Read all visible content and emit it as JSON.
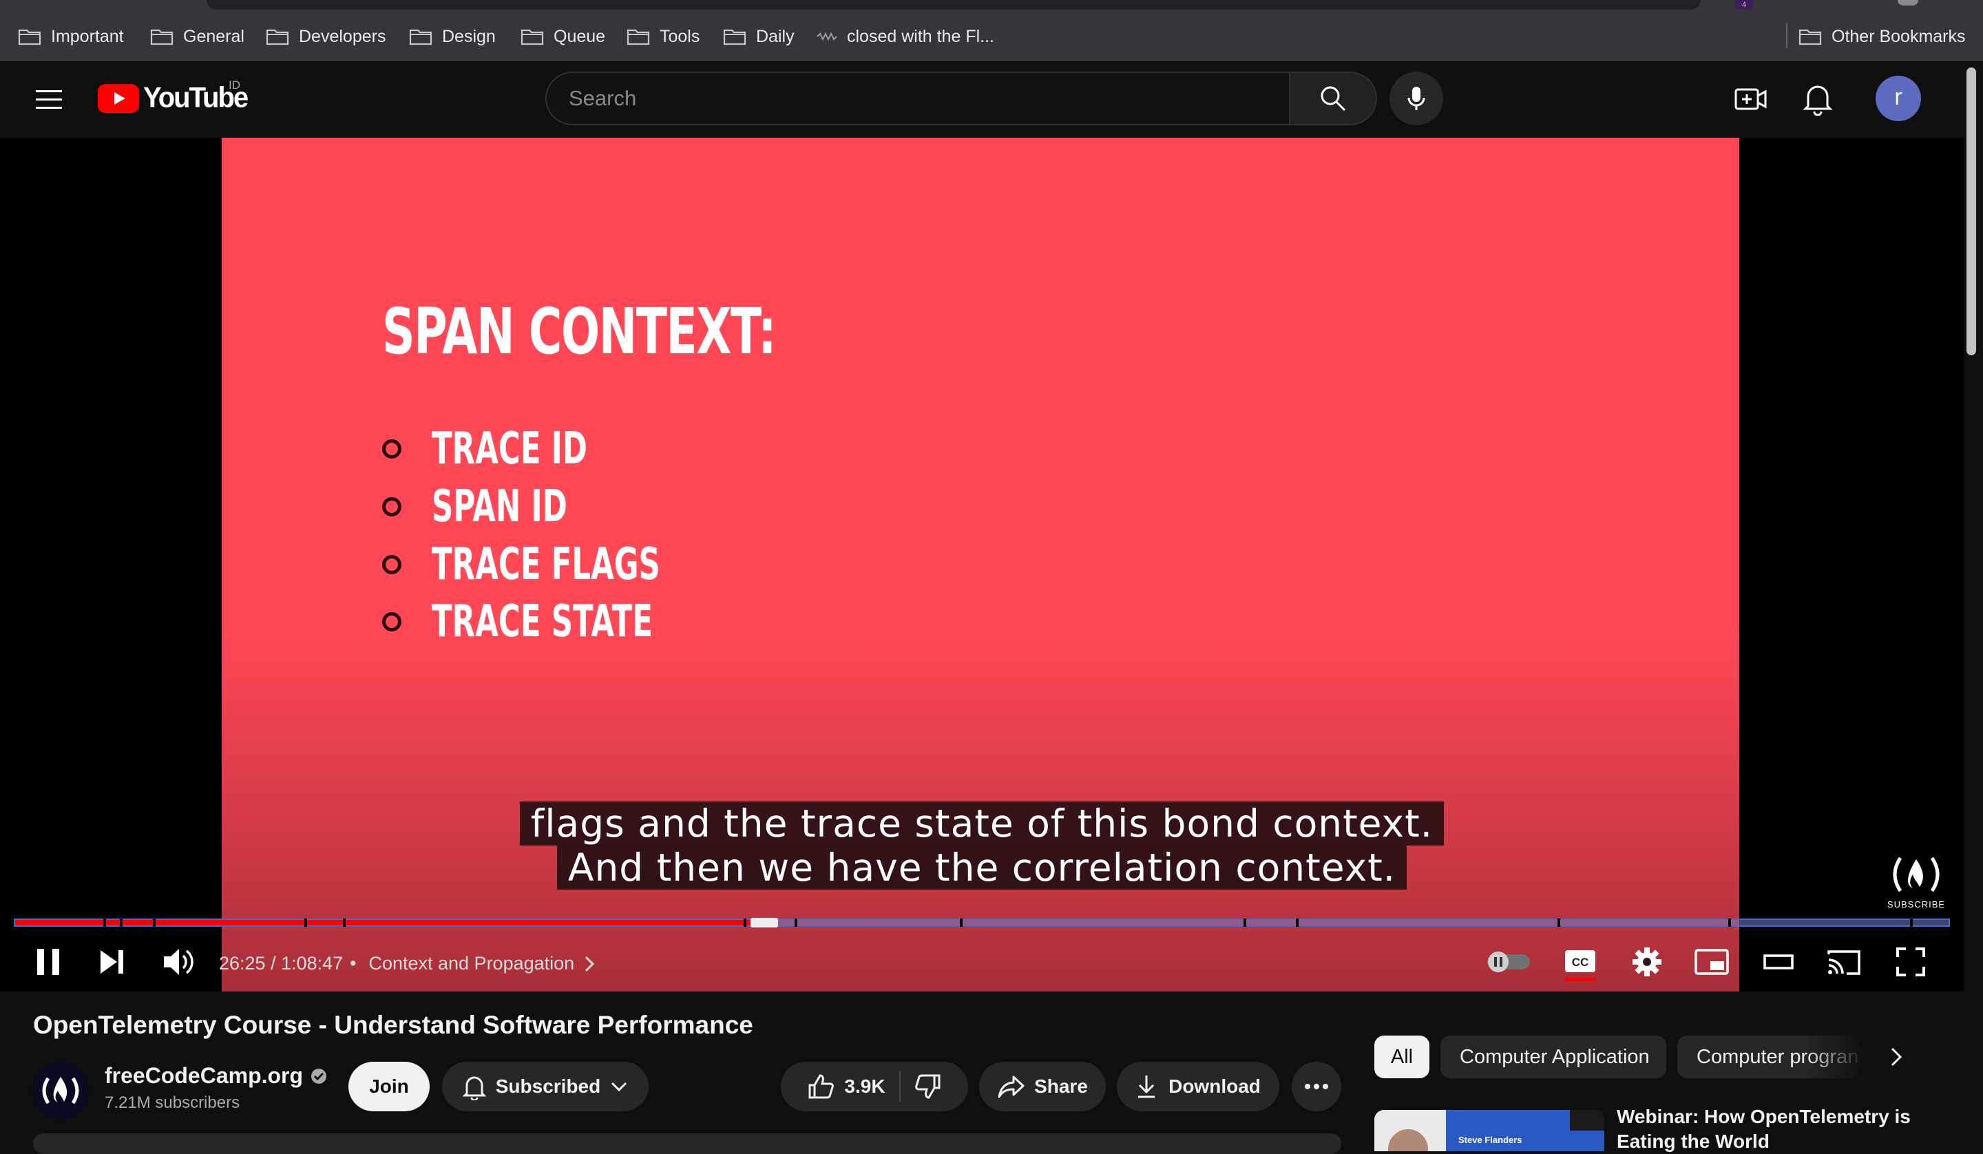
{
  "browser": {
    "bookmarks": [
      "Important",
      "General",
      "Developers",
      "Design",
      "Queue",
      "Tools",
      "Daily"
    ],
    "bookmark_link": "closed with the Fl...",
    "other_bookmarks": "Other Bookmarks",
    "tab_badge": "4"
  },
  "youtube": {
    "logo_text": "YouTube",
    "region": "ID",
    "search_placeholder": "Search",
    "avatar_letter": "r"
  },
  "player": {
    "slide": {
      "title": "SPAN CONTEXT:",
      "bullets": [
        "TRACE ID",
        "SPAN ID",
        "TRACE FLAGS",
        "TRACE STATE"
      ]
    },
    "captions": [
      "flags and the trace state of this bond context.",
      "And then we have the correlation context."
    ],
    "watermark_label": "SUBSCRIBE",
    "time": "26:25 / 1:08:47",
    "chapter_separator": "•",
    "chapter": "Context and Propagation",
    "progress_played_fraction": 0.384,
    "buffer_end_fraction": 0.39
  },
  "video": {
    "title": "OpenTelemetry Course - Understand Software Performance",
    "channel": "freeCodeCamp.org",
    "subscribers": "7.21M subscribers",
    "join_label": "Join",
    "subscribed_label": "Subscribed",
    "likes": "3.9K",
    "share_label": "Share",
    "download_label": "Download"
  },
  "sidebar": {
    "chips": [
      "All",
      "Computer Application",
      "Computer progran"
    ],
    "recommendation": {
      "thumb_text": "Steve Flanders",
      "title": "Webinar: How OpenTelemetry is Eating the World"
    }
  },
  "colors": {
    "slide_bg": "#ff4756",
    "progress_played": "#ff0000",
    "youtube_red": "#ff0000",
    "avatar_bg": "#5c6bc0"
  }
}
